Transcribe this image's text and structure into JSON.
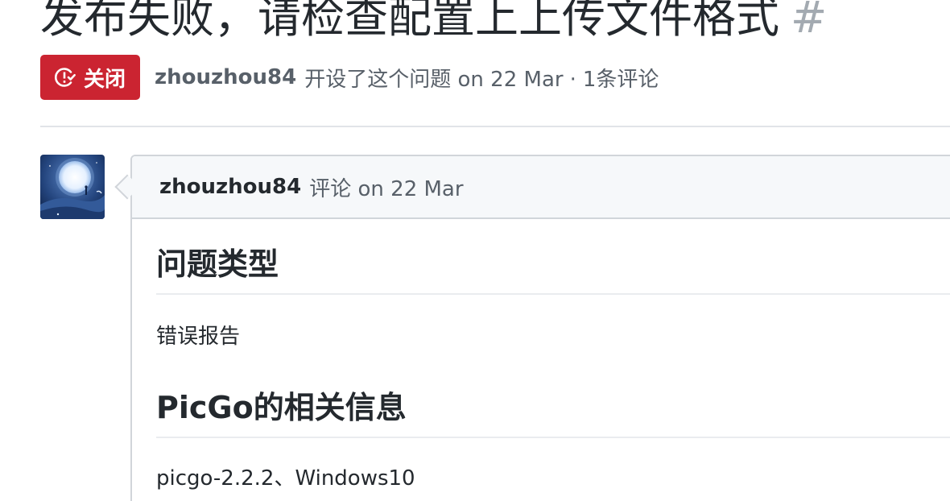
{
  "issue": {
    "title": "发布失败，请检查配置上上传文件格式",
    "number": "#"
  },
  "meta": {
    "state_label": "关闭",
    "state_icon": "issue-closed-icon",
    "author": "zhouzhou84",
    "opened_text": "开设了这个问题",
    "date": "on 22 Mar",
    "separator": "·",
    "comments_count": "1条评论"
  },
  "comment": {
    "author": "zhouzhou84",
    "action": "评论",
    "date": "on 22 Mar",
    "avatar": "moon-night-avatar",
    "sections": [
      {
        "heading": "问题类型",
        "text": "错误报告"
      },
      {
        "heading": "PicGo的相关信息",
        "text": "picgo-2.2.2、Windows10"
      }
    ]
  },
  "colors": {
    "closed_badge": "#cb2431",
    "muted_text": "#586069",
    "border": "#d1d5da",
    "header_bg": "#f6f8fa"
  }
}
